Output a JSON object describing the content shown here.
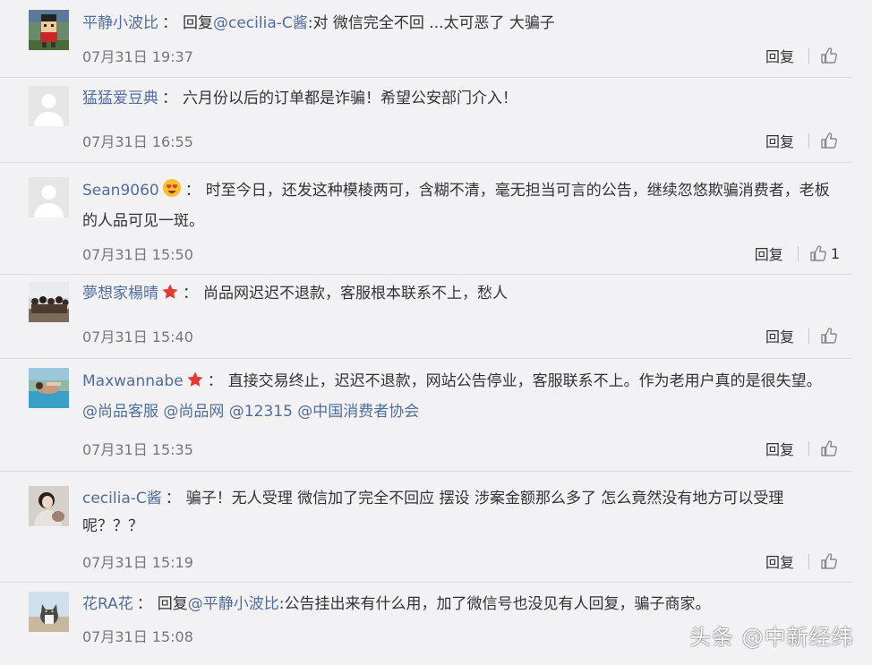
{
  "comments": [
    {
      "username": "平静小波比",
      "has_badge": false,
      "colon": "：",
      "reply_prefix": "回复",
      "mention": "@cecilia-C酱",
      "text": ":对 微信完全不回 ...太可恶了 大骗子",
      "mentions_line": "",
      "time": "07月31日 19:37",
      "reply_label": "回复",
      "likes": "",
      "avatar": "pixel-art-character"
    },
    {
      "username": "猛猛爱豆典",
      "has_badge": false,
      "colon": "：",
      "reply_prefix": "",
      "mention": "",
      "text": "六月份以后的订单都是诈骗！希望公安部门介入！",
      "mentions_line": "",
      "time": "07月31日 16:55",
      "reply_label": "回复",
      "likes": "",
      "avatar": "default-avatar"
    },
    {
      "username": "Sean9060",
      "has_badge": true,
      "badge": "heart-eyes-emoji",
      "colon": "：",
      "reply_prefix": "",
      "mention": "",
      "text": "时至今日，还发这种模棱两可，含糊不清，毫无担当可言的公告，继续忽悠欺骗消费者，老板的人品可见一斑。",
      "mentions_line": "",
      "time": "07月31日 15:50",
      "reply_label": "回复",
      "likes": "1",
      "avatar": "default-avatar"
    },
    {
      "username": "夢想家楊晴",
      "has_badge": true,
      "badge": "red-star",
      "colon": "：",
      "reply_prefix": "",
      "mention": "",
      "text": "尚品网迟迟不退款，客服根本联系不上，愁人",
      "mentions_line": "",
      "time": "07月31日 15:40",
      "reply_label": "回复",
      "likes": "",
      "avatar": "group-photo"
    },
    {
      "username": "Maxwannabe",
      "has_badge": true,
      "badge": "red-star",
      "colon": "：",
      "reply_prefix": "",
      "mention": "",
      "text": "直接交易终止，迟迟不退款，网站公告停业，客服联系不上。作为老用户真的是很失望。",
      "mentions_line": "@尚品客服 @尚品网 @12315 @中国消费者协会",
      "time": "07月31日 15:35",
      "reply_label": "回复",
      "likes": "",
      "avatar": "pool-photo"
    },
    {
      "username": "cecilia-C酱",
      "has_badge": false,
      "colon": "：",
      "reply_prefix": "",
      "mention": "",
      "text": "骗子！无人受理 微信加了完全不回应 摆设 涉案金额那么多了 怎么竟然没有地方可以受理呢？？？",
      "mentions_line": "",
      "time": "07月31日 15:19",
      "reply_label": "回复",
      "likes": "",
      "avatar": "portrait-photo"
    },
    {
      "username": "花RA花",
      "has_badge": false,
      "colon": "：",
      "reply_prefix": "回复",
      "mention": "@平静小波比",
      "text": ":公告挂出来有什么用，加了微信号也没见有人回复，骗子商家。",
      "mentions_line": "",
      "time": "07月31日 15:08",
      "reply_label": "回复",
      "likes": "",
      "avatar": "cat-photo"
    }
  ],
  "watermark": "头条 @中新经纬",
  "colors": {
    "background": "#f2f2f5",
    "username": "#506e9c",
    "text": "#333333",
    "time": "#777777",
    "divider": "#d9d9de"
  }
}
